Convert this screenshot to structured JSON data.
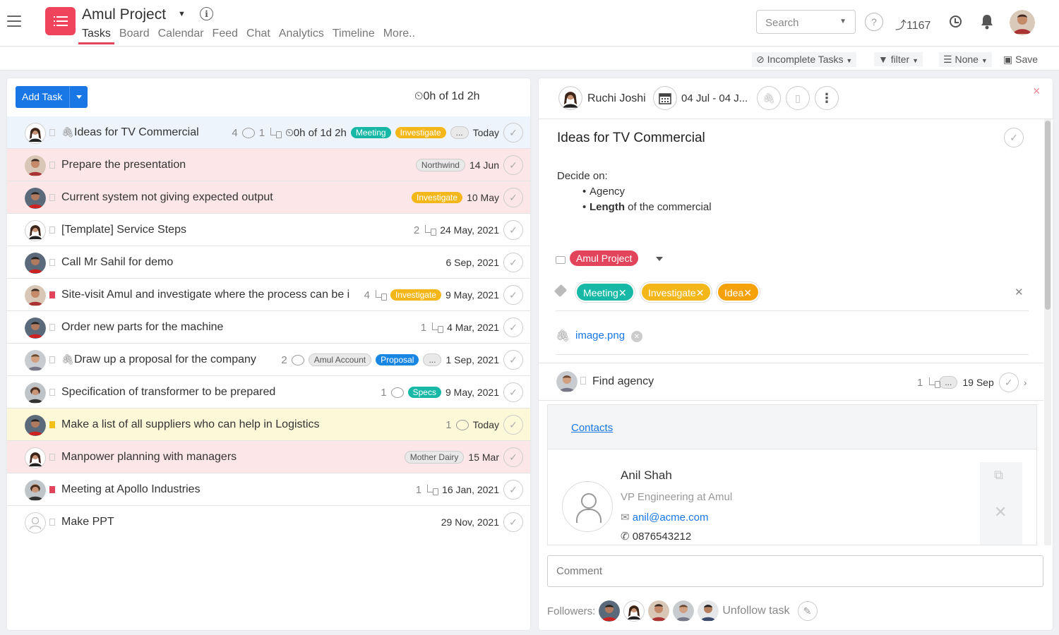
{
  "header": {
    "project_name": "Amul Project",
    "tabs": [
      "Tasks",
      "Board",
      "Calendar",
      "Feed",
      "Chat",
      "Analytics",
      "Timeline",
      "More.."
    ],
    "search_placeholder": "Search",
    "karma": "1167",
    "help": "?"
  },
  "filterbar": {
    "incomplete": "Incomplete Tasks",
    "filter": "filter",
    "group": "None",
    "save": "Save"
  },
  "tasklist": {
    "add_task": "Add Task",
    "total_time": "0h of 1d 2h",
    "tasks": [
      {
        "title": "Ideas for TV Commercial",
        "comments": "4",
        "subtasks": "1",
        "time": "0h of 1d 2h",
        "tags": [
          "Meeting",
          "Investigate",
          "..."
        ],
        "date": "Today"
      },
      {
        "title": "Prepare the presentation",
        "tags": [
          "Northwind"
        ],
        "date": "14 Jun"
      },
      {
        "title": "Current system not giving expected output",
        "tags": [
          "Investigate"
        ],
        "date": "10 May"
      },
      {
        "title": "[Template] Service Steps",
        "subtasks": "2",
        "date": "24 May, 2021"
      },
      {
        "title": "Call Mr Sahil for demo",
        "date": "6 Sep, 2021"
      },
      {
        "title": "Site-visit Amul and investigate where the process can be i",
        "subtasks": "4",
        "tags": [
          "Investigate"
        ],
        "date": "9 May, 2021"
      },
      {
        "title": "Order new parts for the machine",
        "subtasks": "1",
        "date": "4 Mar, 2021"
      },
      {
        "title": "Draw up a proposal for the company",
        "comments": "2",
        "tags": [
          "Amul Account",
          "Proposal",
          "..."
        ],
        "date": "1 Sep, 2021"
      },
      {
        "title": "Specification of transformer to be prepared",
        "comments": "1",
        "tags": [
          "Specs"
        ],
        "date": "9 May, 2021"
      },
      {
        "title": "Make a list of all suppliers who can help in Logistics",
        "comments": "1",
        "date": "Today"
      },
      {
        "title": "Manpower planning with managers",
        "tags": [
          "Mother Dairy"
        ],
        "date": "15 Mar"
      },
      {
        "title": "Meeting at Apollo Industries",
        "subtasks": "1",
        "date": "16 Jan, 2021"
      },
      {
        "title": "Make PPT",
        "date": "29 Nov, 2021"
      }
    ]
  },
  "detail": {
    "assignee": "Ruchi Joshi",
    "dates": "04 Jul - 04 J...",
    "close": "×",
    "title": "Ideas for TV Commercial",
    "desc_intro": "Decide on:",
    "desc_item1": "Agency",
    "desc_item2_bold": "Length",
    "desc_item2_rest": " of the commercial",
    "project_tag": "Amul Project",
    "tags": [
      "Meeting",
      "Investigate",
      "Idea"
    ],
    "attachment": "image.png",
    "subtask": {
      "title": "Find agency",
      "count": "1",
      "more": "...",
      "date": "19 Sep"
    },
    "contacts_label": "Contacts",
    "contact": {
      "name": "Anil Shah",
      "role": "VP Engineering  at  Amul",
      "email": "anil@acme.com",
      "phone": "0876543212"
    },
    "comment_placeholder": "Comment",
    "followers_label": "Followers:",
    "unfollow": "Unfollow task"
  },
  "colors": {
    "brand_red": "#e2445c",
    "primary_blue": "#1877e5",
    "tag_teal": "#17b8a6",
    "tag_yellow": "#f3b71a",
    "row_red_tint": "#fde6e8",
    "row_yellow_tint": "#fdf8d8",
    "row_blue_tint": "#eef4fb"
  }
}
